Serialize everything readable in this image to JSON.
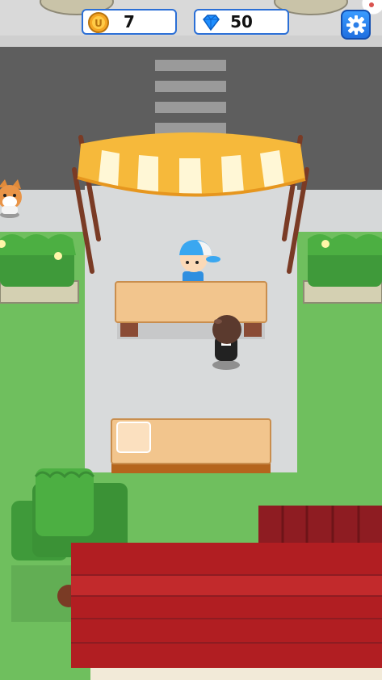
{
  "hud": {
    "coins": {
      "icon": "coin-icon",
      "value": "7"
    },
    "gems": {
      "icon": "gem-icon",
      "value": "50"
    },
    "settings": {
      "icon": "gear-icon"
    }
  },
  "colors": {
    "road": "#5f5f5f",
    "sidewalk": "#d8dadb",
    "grass": "#6fbf5e",
    "counter": "#f2c58d",
    "roof": "#a81d20",
    "awning_stripe": "#f6b93b",
    "hud_border": "#2b6fd6"
  }
}
